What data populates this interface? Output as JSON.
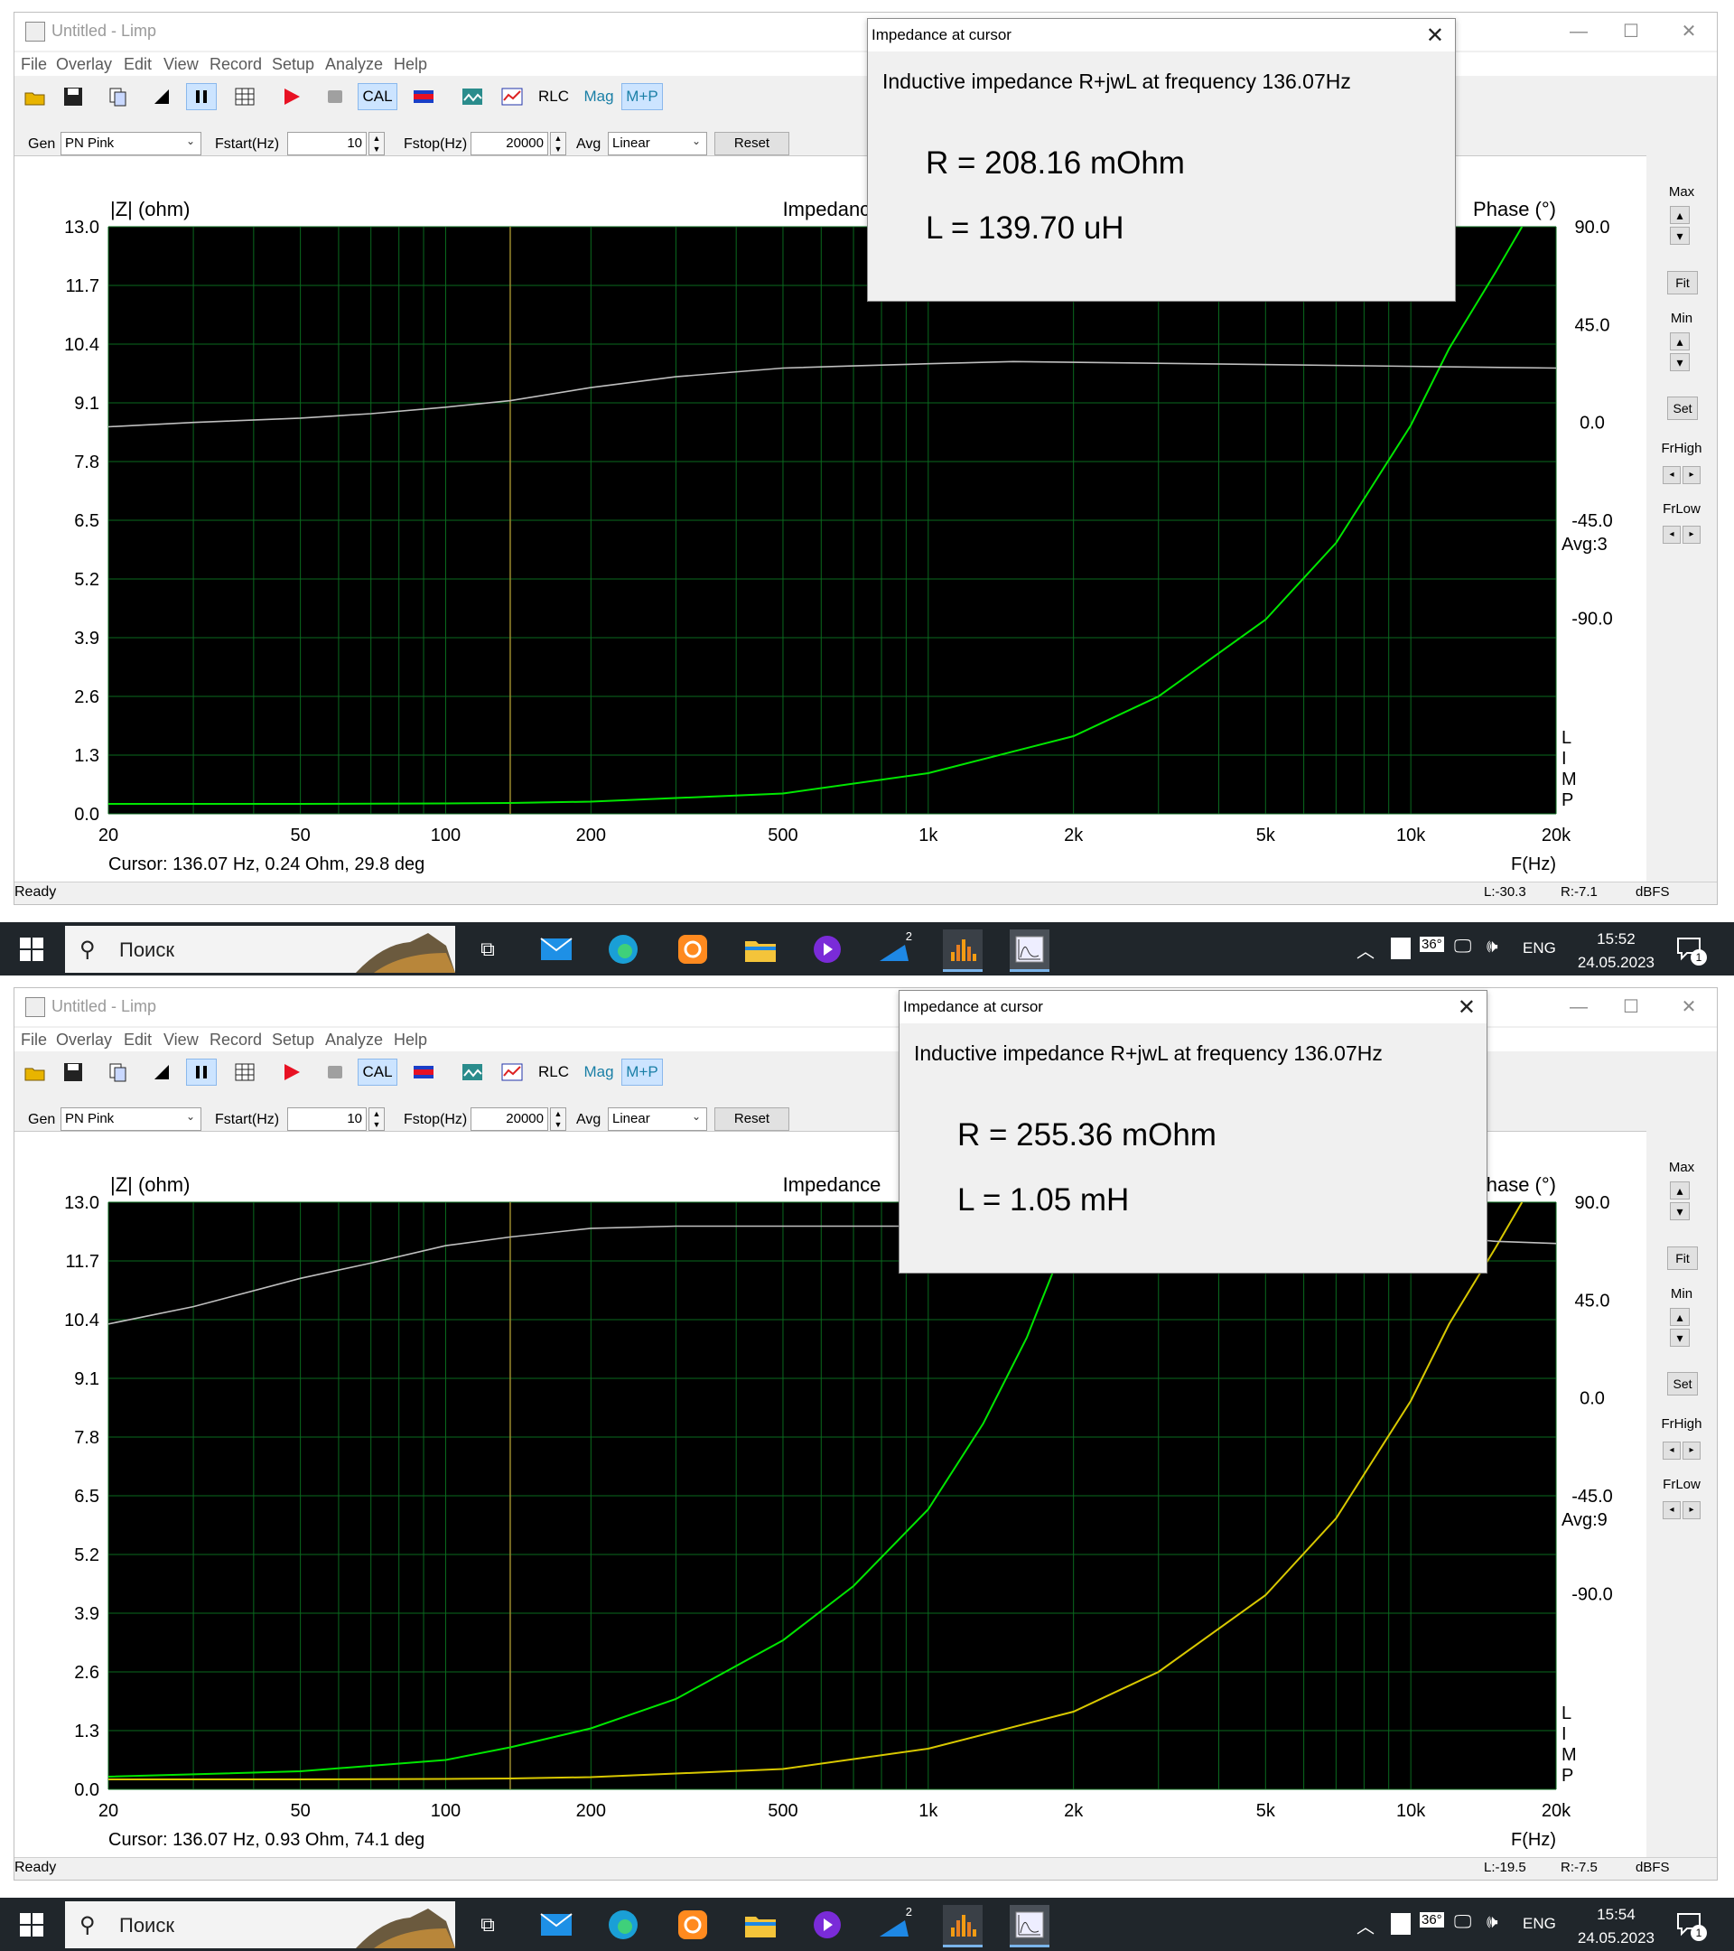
{
  "screens": [
    {
      "window_title": "Untitled - Limp",
      "menu": [
        "File",
        "Overlay",
        "Edit",
        "View",
        "Record",
        "Setup",
        "Analyze",
        "Help"
      ],
      "toolbar": {
        "cal_label": "CAL",
        "rlc_label": "RLC",
        "mag_label": "Mag",
        "mp_label": "M+P"
      },
      "controls": {
        "gen_label": "Gen",
        "gen_value": "PN Pink",
        "fstart_label": "Fstart(Hz)",
        "fstart_value": "10",
        "fstop_label": "Fstop(Hz)",
        "fstop_value": "20000",
        "avg_label": "Avg",
        "avg_value": "Linear",
        "reset_label": "Reset"
      },
      "right_panel": {
        "max": "Max",
        "fit": "Fit",
        "min": "Min",
        "set": "Set",
        "frhigh": "FrHigh",
        "frlow": "FrLow"
      },
      "chart_data": {
        "type": "line",
        "title": "Impedance",
        "ylabel": "|Z| (ohm)",
        "y2label": "Phase (°)",
        "xlabel": "F(Hz)",
        "x_scale": "log",
        "xlim": [
          20,
          20000
        ],
        "ylim": [
          0,
          13
        ],
        "y2lim": [
          -180,
          90
        ],
        "x_ticks": [
          "20",
          "50",
          "100",
          "200",
          "500",
          "1k",
          "2k",
          "5k",
          "10k",
          "20k"
        ],
        "y_ticks": [
          "13.0",
          "11.7",
          "10.4",
          "9.1",
          "7.8",
          "6.5",
          "5.2",
          "3.9",
          "2.6",
          "1.3",
          "0.0"
        ],
        "y2_ticks": [
          "90.0",
          "45.0",
          "0.0",
          "-45.0",
          "-90.0"
        ],
        "avg_label": "Avg:3",
        "limp_letters": [
          "L",
          "I",
          "M",
          "P"
        ],
        "cursor_freq": 136.07,
        "cursor_text": "Cursor: 136.07 Hz, 0.24 Ohm, 29.8 deg",
        "series": [
          {
            "color": "#00e600",
            "kind": "impedance",
            "x": [
              20,
              50,
              100,
              136.07,
              200,
              500,
              1000,
              2000,
              3000,
              5000,
              7000,
              10000,
              12000,
              15000,
              17000
            ],
            "y": [
              0.22,
              0.22,
              0.23,
              0.24,
              0.27,
              0.45,
              0.9,
              1.72,
              2.6,
              4.3,
              6.0,
              8.6,
              10.3,
              12.0,
              13.0
            ]
          },
          {
            "color": "#bfbfbf",
            "kind": "phase",
            "x": [
              20,
              30,
              50,
              70,
              100,
              136.07,
              200,
              300,
              500,
              700,
              1000,
              1500,
              20000
            ],
            "y": [
              -2,
              0,
              2,
              4,
              7,
              10,
              16,
              21,
              25,
              26,
              27,
              28,
              25
            ]
          }
        ]
      },
      "dialog": {
        "title": "Impedance at cursor",
        "desc": "Inductive impedance R+jwL at frequency 136.07Hz",
        "r": "R = 208.16 mOhm",
        "l": "L = 139.70 uH"
      },
      "status": {
        "ready": "Ready",
        "l": "L:-30.3",
        "r": "R:-7.1",
        "unit": "dBFS"
      },
      "taskbar": {
        "search": "Поиск",
        "temp": "36°",
        "lang": "ENG",
        "time": "15:52",
        "date": "24.05.2023",
        "notif": "1",
        "badge": "2"
      }
    },
    {
      "window_title": "Untitled - Limp",
      "menu": [
        "File",
        "Overlay",
        "Edit",
        "View",
        "Record",
        "Setup",
        "Analyze",
        "Help"
      ],
      "toolbar": {
        "cal_label": "CAL",
        "rlc_label": "RLC",
        "mag_label": "Mag",
        "mp_label": "M+P"
      },
      "controls": {
        "gen_label": "Gen",
        "gen_value": "PN Pink",
        "fstart_label": "Fstart(Hz)",
        "fstart_value": "10",
        "fstop_label": "Fstop(Hz)",
        "fstop_value": "20000",
        "avg_label": "Avg",
        "avg_value": "Linear",
        "reset_label": "Reset"
      },
      "right_panel": {
        "max": "Max",
        "fit": "Fit",
        "min": "Min",
        "set": "Set",
        "frhigh": "FrHigh",
        "frlow": "FrLow"
      },
      "chart_data": {
        "type": "line",
        "title": "Impedance",
        "ylabel": "|Z| (ohm)",
        "y2label": "Phase (°)",
        "xlabel": "F(Hz)",
        "x_scale": "log",
        "xlim": [
          20,
          20000
        ],
        "ylim": [
          0,
          13
        ],
        "y2lim": [
          -180,
          90
        ],
        "x_ticks": [
          "20",
          "50",
          "100",
          "200",
          "500",
          "1k",
          "2k",
          "5k",
          "10k",
          "20k"
        ],
        "y_ticks": [
          "13.0",
          "11.7",
          "10.4",
          "9.1",
          "7.8",
          "6.5",
          "5.2",
          "3.9",
          "2.6",
          "1.3",
          "0.0"
        ],
        "y2_ticks": [
          "90.0",
          "45.0",
          "0.0",
          "-45.0",
          "-90.0"
        ],
        "avg_label": "Avg:9",
        "limp_letters": [
          "L",
          "I",
          "M",
          "P"
        ],
        "cursor_freq": 136.07,
        "cursor_text": "Cursor: 136.07 Hz, 0.93 Ohm, 74.1 deg",
        "series": [
          {
            "color": "#00e600",
            "kind": "impedance",
            "x": [
              20,
              50,
              100,
              136.07,
              200,
              300,
              500,
              700,
              1000,
              1300,
              1600,
              1900,
              2100
            ],
            "y": [
              0.28,
              0.4,
              0.65,
              0.93,
              1.35,
              2.0,
              3.3,
              4.5,
              6.2,
              8.1,
              10.0,
              12.0,
              13.0
            ]
          },
          {
            "color": "#d8c800",
            "kind": "impedance-overlay",
            "x": [
              20,
              50,
              100,
              136.07,
              200,
              500,
              1000,
              2000,
              3000,
              5000,
              7000,
              10000,
              12000,
              15000,
              17000
            ],
            "y": [
              0.22,
              0.22,
              0.23,
              0.24,
              0.27,
              0.45,
              0.9,
              1.72,
              2.6,
              4.3,
              6.0,
              8.6,
              10.3,
              12.0,
              13.0
            ]
          },
          {
            "color": "#bfbfbf",
            "kind": "phase",
            "x": [
              20,
              30,
              50,
              70,
              100,
              136.07,
              200,
              300,
              500,
              1000,
              2000,
              5000,
              10000,
              15000,
              20000
            ],
            "y": [
              34,
              42,
              55,
              62,
              70,
              74,
              78,
              79,
              79,
              79,
              78,
              77,
              75,
              72,
              71
            ]
          }
        ]
      },
      "dialog": {
        "title": "Impedance at cursor",
        "desc": "Inductive impedance R+jwL at frequency 136.07Hz",
        "r": "R = 255.36 mOhm",
        "l": "L = 1.05 mH"
      },
      "status": {
        "ready": "Ready",
        "l": "L:-19.5",
        "r": "R:-7.5",
        "unit": "dBFS"
      },
      "taskbar": {
        "search": "Поиск",
        "temp": "36°",
        "lang": "ENG",
        "time": "15:54",
        "date": "24.05.2023",
        "notif": "1",
        "badge": "2"
      }
    }
  ]
}
